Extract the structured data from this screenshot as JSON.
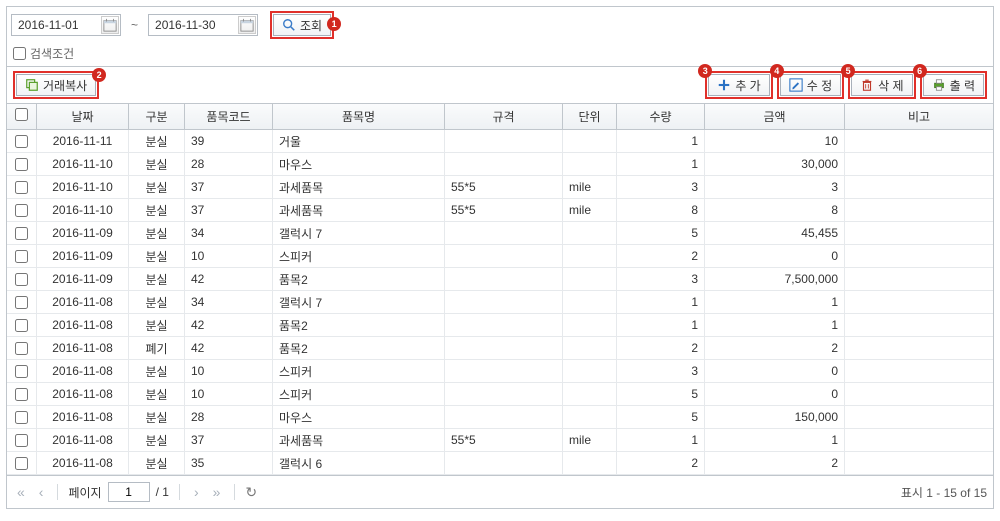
{
  "dateFrom": "2016-11-01",
  "dateTo": "2016-11-30",
  "searchBtn": "조회",
  "searchCond": "검색조건",
  "copyBtn": "거래복사",
  "addBtn": "추 가",
  "editBtn": "수 정",
  "delBtn": "삭 제",
  "printBtn": "출 력",
  "badges": {
    "b1": "1",
    "b2": "2",
    "b3": "3",
    "b4": "4",
    "b5": "5",
    "b6": "6"
  },
  "headers": {
    "date": "날짜",
    "gubun": "구분",
    "code": "품목코드",
    "name": "품목명",
    "spec": "규격",
    "unit": "단위",
    "qty": "수량",
    "amt": "금액",
    "note": "비고"
  },
  "rows": [
    {
      "date": "2016-11-11",
      "gubun": "분실",
      "code": "39",
      "name": "거울",
      "spec": "",
      "unit": "",
      "qty": "1",
      "amt": "10"
    },
    {
      "date": "2016-11-10",
      "gubun": "분실",
      "code": "28",
      "name": "마우스",
      "spec": "",
      "unit": "",
      "qty": "1",
      "amt": "30,000"
    },
    {
      "date": "2016-11-10",
      "gubun": "분실",
      "code": "37",
      "name": "과세품목",
      "spec": "55*5",
      "unit": "mile",
      "qty": "3",
      "amt": "3"
    },
    {
      "date": "2016-11-10",
      "gubun": "분실",
      "code": "37",
      "name": "과세품목",
      "spec": "55*5",
      "unit": "mile",
      "qty": "8",
      "amt": "8"
    },
    {
      "date": "2016-11-09",
      "gubun": "분실",
      "code": "34",
      "name": "갤럭시 7",
      "spec": "",
      "unit": "",
      "qty": "5",
      "amt": "45,455"
    },
    {
      "date": "2016-11-09",
      "gubun": "분실",
      "code": "10",
      "name": "스피커",
      "spec": "",
      "unit": "",
      "qty": "2",
      "amt": "0"
    },
    {
      "date": "2016-11-09",
      "gubun": "분실",
      "code": "42",
      "name": "품목2",
      "spec": "",
      "unit": "",
      "qty": "3",
      "amt": "7,500,000"
    },
    {
      "date": "2016-11-08",
      "gubun": "분실",
      "code": "34",
      "name": "갤럭시 7",
      "spec": "",
      "unit": "",
      "qty": "1",
      "amt": "1"
    },
    {
      "date": "2016-11-08",
      "gubun": "분실",
      "code": "42",
      "name": "품목2",
      "spec": "",
      "unit": "",
      "qty": "1",
      "amt": "1"
    },
    {
      "date": "2016-11-08",
      "gubun": "폐기",
      "code": "42",
      "name": "품목2",
      "spec": "",
      "unit": "",
      "qty": "2",
      "amt": "2"
    },
    {
      "date": "2016-11-08",
      "gubun": "분실",
      "code": "10",
      "name": "스피커",
      "spec": "",
      "unit": "",
      "qty": "3",
      "amt": "0"
    },
    {
      "date": "2016-11-08",
      "gubun": "분실",
      "code": "10",
      "name": "스피커",
      "spec": "",
      "unit": "",
      "qty": "5",
      "amt": "0"
    },
    {
      "date": "2016-11-08",
      "gubun": "분실",
      "code": "28",
      "name": "마우스",
      "spec": "",
      "unit": "",
      "qty": "5",
      "amt": "150,000"
    },
    {
      "date": "2016-11-08",
      "gubun": "분실",
      "code": "37",
      "name": "과세품목",
      "spec": "55*5",
      "unit": "mile",
      "qty": "1",
      "amt": "1"
    },
    {
      "date": "2016-11-08",
      "gubun": "분실",
      "code": "35",
      "name": "갤럭시 6",
      "spec": "",
      "unit": "",
      "qty": "2",
      "amt": "2"
    }
  ],
  "pager": {
    "pageLabel": "페이지",
    "page": "1",
    "totalPages": "/ 1",
    "info": "표시 1 - 15 of 15"
  }
}
